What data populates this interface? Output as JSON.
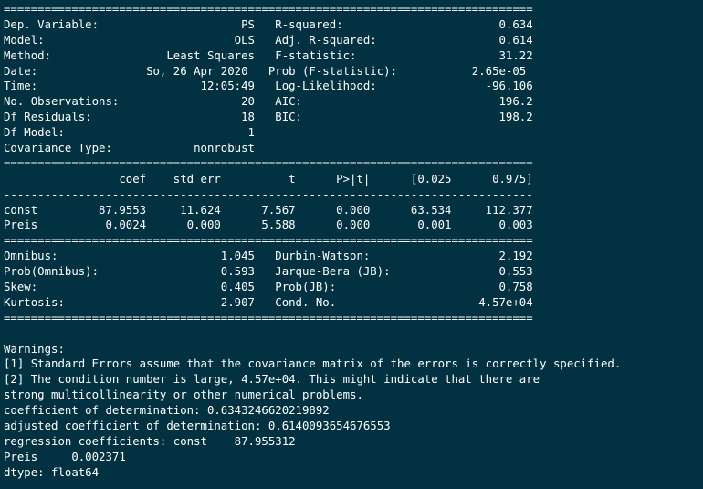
{
  "colors": {
    "background": "#023241",
    "text": "#ffffff"
  },
  "terminal": {
    "lines": [
      "==============================================================================",
      "Dep. Variable:                     PS   R-squared:                       0.634",
      "Model:                            OLS   Adj. R-squared:                  0.614",
      "Method:                 Least Squares   F-statistic:                     31.22",
      "Date:                So, 26 Apr 2020   Prob (F-statistic):           2.65e-05",
      "Time:                        12:05:49   Log-Likelihood:                -96.106",
      "No. Observations:                  20   AIC:                             196.2",
      "Df Residuals:                      18   BIC:                             198.2",
      "Df Model:                           1",
      "Covariance Type:            nonrobust",
      "==============================================================================",
      "                 coef    std err          t      P>|t|      [0.025      0.975]",
      "------------------------------------------------------------------------------",
      "const         87.9553     11.624      7.567      0.000      63.534     112.377",
      "Preis          0.0024      0.000      5.588      0.000       0.001       0.003",
      "==============================================================================",
      "Omnibus:                        1.045   Durbin-Watson:                   2.192",
      "Prob(Omnibus):                  0.593   Jarque-Bera (JB):                0.553",
      "Skew:                           0.405   Prob(JB):                        0.758",
      "Kurtosis:                       2.907   Cond. No.                     4.57e+04",
      "==============================================================================",
      "",
      "Warnings:",
      "[1] Standard Errors assume that the covariance matrix of the errors is correctly specified.",
      "[2] The condition number is large, 4.57e+04. This might indicate that there are",
      "strong multicollinearity or other numerical problems.",
      "coefficient of determination: 0.6343246620219892",
      "adjusted coefficient of determination: 0.6140093654676553",
      "regression coefficients: const    87.955312",
      "Preis     0.002371",
      "dtype: float64"
    ]
  }
}
